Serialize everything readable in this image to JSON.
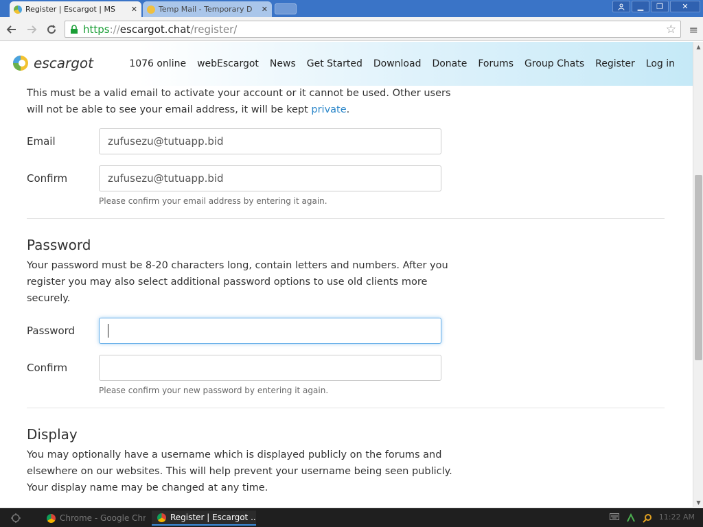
{
  "browser": {
    "tabs": [
      {
        "label": "Register | Escargot | MS",
        "active": true
      },
      {
        "label": "Temp Mail - Temporary D",
        "active": false
      }
    ],
    "url": {
      "scheme": "https",
      "separator": "://",
      "host": "escargot.chat",
      "path": "/register/"
    }
  },
  "site": {
    "logo_text": "escargot",
    "nav": [
      "1076 online",
      "webEscargot",
      "News",
      "Get Started",
      "Download",
      "Donate",
      "Forums",
      "Group Chats",
      "Register",
      "Log in"
    ]
  },
  "form": {
    "email_intro": "This must be a valid email to activate your account or it cannot be used. Other users will not be able to see your email address, it will be kept ",
    "email_intro_link": "private",
    "email_intro_end": ".",
    "email_label": "Email",
    "email_value": "zufusezu@tutuapp.bid",
    "email_confirm_label": "Confirm",
    "email_confirm_value": "zufusezu@tutuapp.bid",
    "email_help": "Please confirm your email address by entering it again.",
    "password_heading": "Password",
    "password_intro": "Your password must be 8-20 characters long, contain letters and numbers. After you register you may also select additional password options to use old clients more securely.",
    "password_label": "Password",
    "password_value": "",
    "password_confirm_label": "Confirm",
    "password_confirm_value": "",
    "password_help": "Please confirm your new password by entering it again.",
    "display_heading": "Display",
    "display_intro": "You may optionally have a username which is displayed publicly on the forums and elsewhere on our websites. This will help prevent your username being seen publicly. Your display name may be changed at any time."
  },
  "taskbar": {
    "items": [
      {
        "label": "Chrome - Google Chr..."
      },
      {
        "label": "Register | Escargot ..."
      }
    ],
    "clock": "11:22 AM"
  },
  "colors": {
    "link": "#2a86c9",
    "titlebar": "#3a74c7",
    "focus": "#66afe9"
  }
}
